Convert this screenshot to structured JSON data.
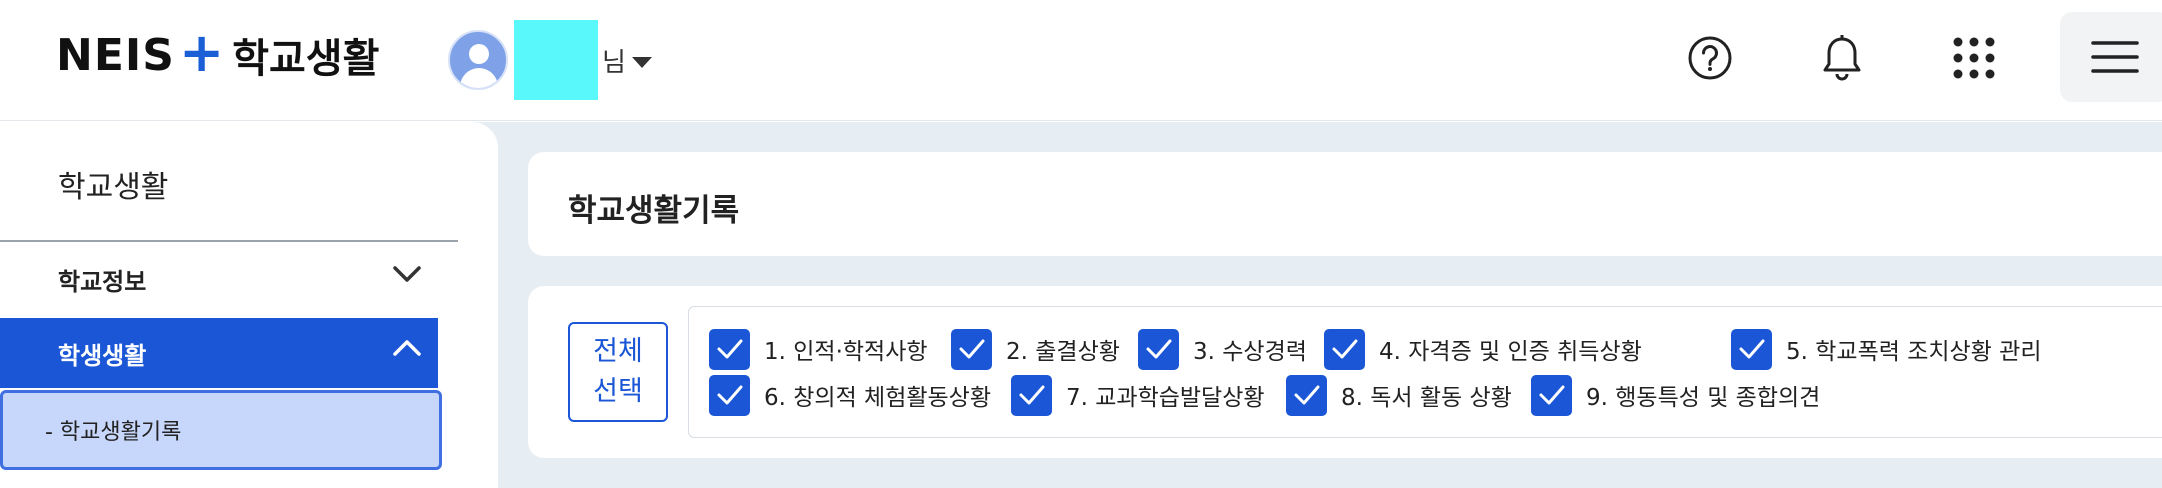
{
  "header": {
    "logo_neis": "NEIS",
    "logo_plus": "+",
    "logo_text": "학교생활",
    "user_suffix": "님",
    "icons": [
      "help-icon",
      "bell-icon",
      "apps-grid-icon",
      "menu-icon"
    ]
  },
  "sidebar": {
    "title": "학교생활",
    "items": [
      {
        "label": "학교정보",
        "expanded": false
      },
      {
        "label": "학생생활",
        "expanded": true
      }
    ],
    "sub_item": "- 학교생활기록"
  },
  "content": {
    "title": "학교생활기록",
    "select_all_line1": "전체",
    "select_all_line2": "선택",
    "checkboxes": [
      {
        "label": "1. 인적·학적사항",
        "checked": true
      },
      {
        "label": "2. 출결상황",
        "checked": true
      },
      {
        "label": "3. 수상경력",
        "checked": true
      },
      {
        "label": "4. 자격증 및 인증 취득상황",
        "checked": true
      },
      {
        "label": "5. 학교폭력 조치상황 관리",
        "checked": true
      },
      {
        "label": "6. 창의적 체험활동상황",
        "checked": true
      },
      {
        "label": "7. 교과학습발달상황",
        "checked": true
      },
      {
        "label": "8. 독서 활동 상황",
        "checked": true
      },
      {
        "label": "9. 행동특성 및 종합의견",
        "checked": true
      }
    ]
  },
  "colors": {
    "accent": "#1a56d6",
    "redacted": "#58f8fb",
    "page_bg": "#e6edf3"
  }
}
